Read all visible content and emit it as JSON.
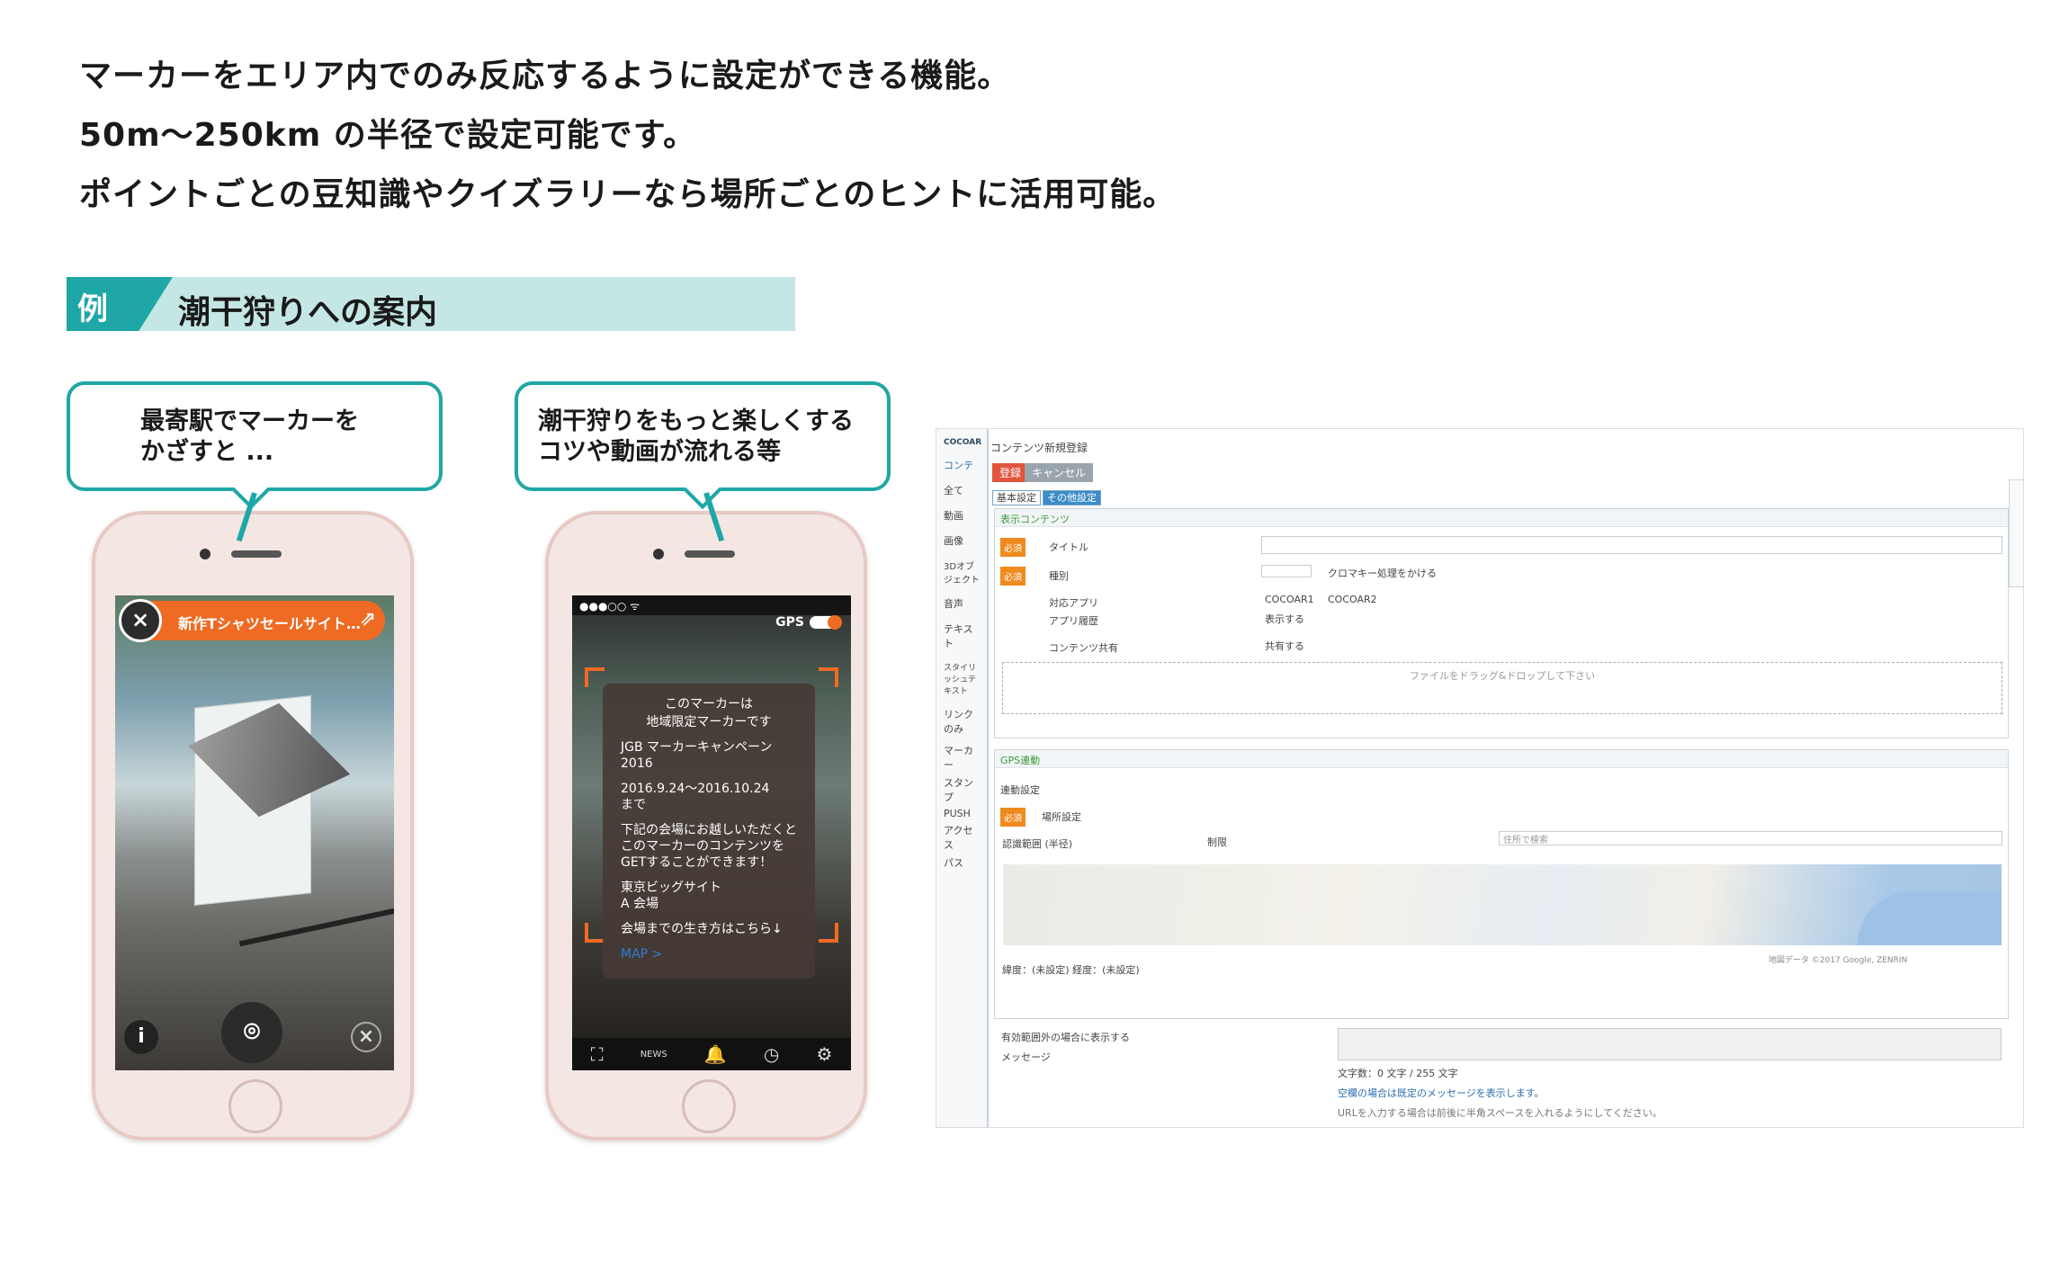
{
  "intro": {
    "line1": "マーカーをエリア内でのみ反応するように設定ができる機能。",
    "line2": "50m〜250km の半径で設定可能です。",
    "line3": "ポイントごとの豆知識やクイズラリーなら場所ごとのヒントに活用可能。"
  },
  "example": {
    "tag": "例",
    "title": "潮干狩りへの案内"
  },
  "bubble1": {
    "line1": "最寄駅でマーカーを",
    "line2": "かざすと ..."
  },
  "bubble2": {
    "line1": "潮干狩りをもっと楽しくする",
    "line2": "コツや動画が流れる等"
  },
  "phone1": {
    "banner_text": "新作Tシャツセールサイト…",
    "close_glyph": "×",
    "link_glyph": "⇗",
    "info_glyph": "i",
    "camera_glyph": "⌾",
    "dismiss_glyph": "×"
  },
  "phone2": {
    "status": "●●●○○ ᯤ",
    "gps_label": "GPS",
    "popup": {
      "l1": "このマーカーは",
      "l2": "地域限定マーカーです",
      "l3": "JGB マーカーキャンペーン 2016",
      "l4": "2016.9.24〜2016.10.24",
      "l5": "まで",
      "l6": "下記の会場にお越しいただくと",
      "l7": "このマーカーのコンテンツを",
      "l8": "GETすることができます！",
      "l9": "東京ビッグサイト",
      "l10": "A 会場",
      "l11": "会場までの生き方はこちら↓",
      "l12": "MAP >"
    },
    "tabs": [
      "⛶",
      "NEWS",
      "🔔",
      "◷",
      "⚙"
    ]
  },
  "admin": {
    "logo": "COCOAR",
    "sidebar": [
      "コンテ",
      "全て",
      "動画",
      "画像",
      "3Dオブジェクト",
      "音声",
      "テキスト",
      "スタイリッシュテキスト",
      "リンクのみ",
      "マーカー",
      "スタンプ",
      "PUSH",
      "アクセス",
      "パス"
    ],
    "header": "コンテンツ新規登録",
    "btn_register": "登録",
    "btn_cancel": "キャンセル",
    "tab_basic": "基本設定",
    "tab_other": "その他設定",
    "sec_display": "表示コンテンツ",
    "required": "必須",
    "f_title": "タイトル",
    "f_type": "種別",
    "f_type_opt": "クロマキー処理をかける",
    "f_app": "対応アプリ",
    "f_app_v1": "COCOAR1",
    "f_app_v2": "COCOAR2",
    "f_hist": "アプリ履歴",
    "f_hist_v": "表示する",
    "f_share": "コンテンツ共有",
    "f_share_v": "共有する",
    "drop": "ファイルをドラッグ&ドロップして下さい",
    "sec_gps": "GPS連動",
    "gps_set": "連動設定",
    "place": "場所設定",
    "range": "認識範囲 (半径)",
    "unset": "制限",
    "addr": "住所で検索",
    "coords": "緯度：(未設定) 経度：(未設定)",
    "map_credit": "地図データ ©2017 Google, ZENRIN",
    "outside": "有効範囲外の場合に表示する",
    "message": "メッセージ",
    "counter": "文字数：0 文字 / 255 文字",
    "note1": "空欄の場合は既定のメッセージを表示します。",
    "note2": "URLを入力する場合は前後に半角スペースを入れるようにしてください。"
  },
  "colors": {
    "teal": "#1ea7a6",
    "orange": "#ef6b23",
    "banner": "#c4e6e4"
  }
}
